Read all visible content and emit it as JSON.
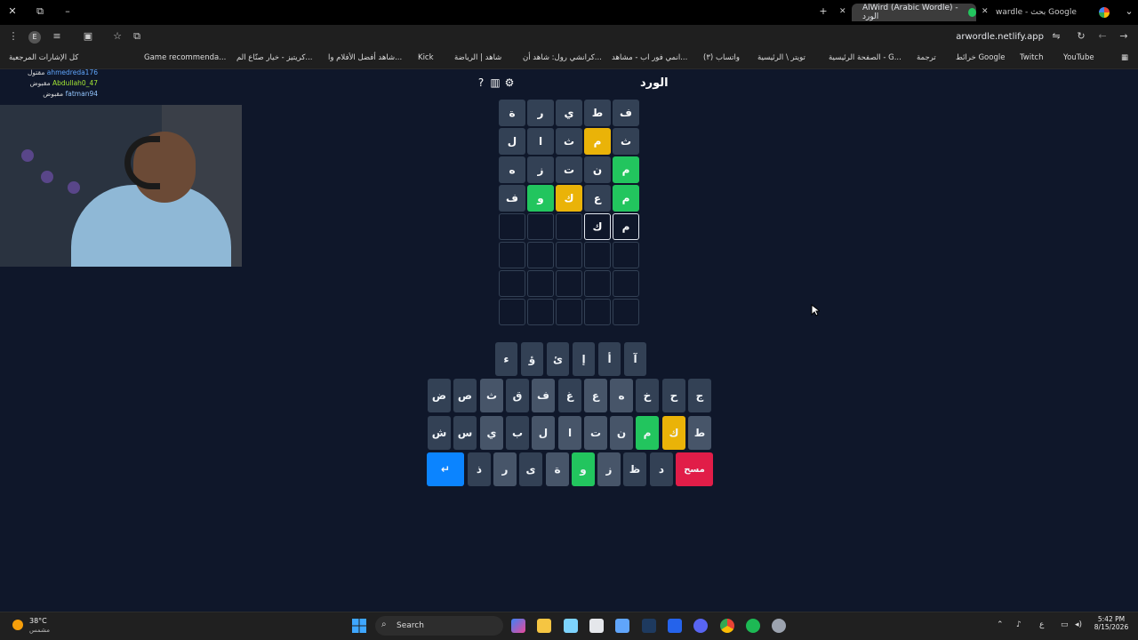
{
  "browser": {
    "tabs": [
      {
        "label": "AlWird (Arabic Wordle) - الورد",
        "active": true
      },
      {
        "label": "wardle - بحث Google",
        "active": false
      }
    ],
    "new_tab_glyph": "+",
    "url": "arwordle.netlify.app",
    "profile_letter": "E",
    "bookmarks": [
      {
        "label": "كل الإشارات المرجعية"
      },
      {
        "label": "Game recommenda..."
      },
      {
        "label": "كريتيز - خيار صنّاع الم..."
      },
      {
        "label": "شاهد أفضل الأفلام وا..."
      },
      {
        "label": "Kick"
      },
      {
        "label": "شاهد | الرياضة"
      },
      {
        "label": "كرانشي رول: شاهد أن..."
      },
      {
        "label": "انمي فور اب - مشاهد..."
      },
      {
        "label": "(٣) واتساب"
      },
      {
        "label": "تويتر \\ الرئيسية"
      },
      {
        "label": "الصفحة الرئيسية - G..."
      },
      {
        "label": "ترجمة"
      },
      {
        "label": "خرائط Google"
      },
      {
        "label": "Twitch"
      },
      {
        "label": "YouTube"
      }
    ]
  },
  "chat": [
    {
      "user": "ahmedreda176",
      "status": "مقتول",
      "color": "#60a5fa"
    },
    {
      "user": "Abdullah0_47",
      "status": "مقبوض",
      "color": "#a3e635"
    },
    {
      "user": "fatman94",
      "status": "مقبوض",
      "color": "#93c5fd"
    }
  ],
  "game": {
    "title": "الورد",
    "icons": [
      "help-icon",
      "stats-icon",
      "settings-icon"
    ],
    "rows": [
      [
        {
          "l": "ف",
          "s": "gray"
        },
        {
          "l": "ط",
          "s": "gray"
        },
        {
          "l": "ي",
          "s": "gray"
        },
        {
          "l": "ر",
          "s": "gray"
        },
        {
          "l": "ة",
          "s": "gray"
        }
      ],
      [
        {
          "l": "ث",
          "s": "gray"
        },
        {
          "l": "م",
          "s": "yellow"
        },
        {
          "l": "ث",
          "s": "gray"
        },
        {
          "l": "ا",
          "s": "gray"
        },
        {
          "l": "ل",
          "s": "gray"
        }
      ],
      [
        {
          "l": "م",
          "s": "green"
        },
        {
          "l": "ن",
          "s": "gray"
        },
        {
          "l": "ت",
          "s": "gray"
        },
        {
          "l": "ز",
          "s": "gray"
        },
        {
          "l": "ه",
          "s": "gray"
        }
      ],
      [
        {
          "l": "م",
          "s": "green"
        },
        {
          "l": "ع",
          "s": "gray"
        },
        {
          "l": "ك",
          "s": "yellow"
        },
        {
          "l": "و",
          "s": "green"
        },
        {
          "l": "ف",
          "s": "gray"
        }
      ],
      [
        {
          "l": "م",
          "s": "typed"
        },
        {
          "l": "ك",
          "s": "typed"
        },
        {
          "l": "",
          "s": "empty"
        },
        {
          "l": "",
          "s": "empty"
        },
        {
          "l": "",
          "s": "empty"
        }
      ],
      [
        {
          "l": "",
          "s": "empty"
        },
        {
          "l": "",
          "s": "empty"
        },
        {
          "l": "",
          "s": "empty"
        },
        {
          "l": "",
          "s": "empty"
        },
        {
          "l": "",
          "s": "empty"
        }
      ],
      [
        {
          "l": "",
          "s": "empty"
        },
        {
          "l": "",
          "s": "empty"
        },
        {
          "l": "",
          "s": "empty"
        },
        {
          "l": "",
          "s": "empty"
        },
        {
          "l": "",
          "s": "empty"
        }
      ],
      [
        {
          "l": "",
          "s": "empty"
        },
        {
          "l": "",
          "s": "empty"
        },
        {
          "l": "",
          "s": "empty"
        },
        {
          "l": "",
          "s": "empty"
        },
        {
          "l": "",
          "s": "empty"
        }
      ]
    ],
    "keyboard": [
      [
        {
          "l": "آ",
          "s": ""
        },
        {
          "l": "أ",
          "s": ""
        },
        {
          "l": "إ",
          "s": ""
        },
        {
          "l": "ئ",
          "s": ""
        },
        {
          "l": "ؤ",
          "s": ""
        },
        {
          "l": "ء",
          "s": ""
        }
      ],
      [
        {
          "l": "ج",
          "s": ""
        },
        {
          "l": "ح",
          "s": ""
        },
        {
          "l": "خ",
          "s": ""
        },
        {
          "l": "ه",
          "s": "gray"
        },
        {
          "l": "ع",
          "s": "gray"
        },
        {
          "l": "غ",
          "s": ""
        },
        {
          "l": "ف",
          "s": "gray"
        },
        {
          "l": "ق",
          "s": ""
        },
        {
          "l": "ث",
          "s": "gray"
        },
        {
          "l": "ص",
          "s": ""
        },
        {
          "l": "ض",
          "s": ""
        }
      ],
      [
        {
          "l": "ط",
          "s": "gray"
        },
        {
          "l": "ك",
          "s": "yellow"
        },
        {
          "l": "م",
          "s": "green"
        },
        {
          "l": "ن",
          "s": "gray"
        },
        {
          "l": "ت",
          "s": "gray"
        },
        {
          "l": "ا",
          "s": "gray"
        },
        {
          "l": "ل",
          "s": "gray"
        },
        {
          "l": "ب",
          "s": ""
        },
        {
          "l": "ي",
          "s": "gray"
        },
        {
          "l": "س",
          "s": ""
        },
        {
          "l": "ش",
          "s": ""
        }
      ],
      [
        {
          "l": "مسح",
          "s": "red"
        },
        {
          "l": "د",
          "s": ""
        },
        {
          "l": "ظ",
          "s": ""
        },
        {
          "l": "ز",
          "s": "gray"
        },
        {
          "l": "و",
          "s": "green"
        },
        {
          "l": "ة",
          "s": "gray"
        },
        {
          "l": "ى",
          "s": ""
        },
        {
          "l": "ر",
          "s": "gray"
        },
        {
          "l": "ذ",
          "s": ""
        },
        {
          "l": "↵",
          "s": "blue"
        }
      ]
    ]
  },
  "taskbar": {
    "temp": "38°C",
    "condition": "مشمس",
    "search": "Search",
    "lang": "ع",
    "time": "5:42 PM",
    "date": "8/15/2026"
  },
  "colors": {
    "green": "#22c55e",
    "yellow": "#eab308",
    "tile_gray": "#334155",
    "enter": "#0b84ff",
    "delete": "#e11d48"
  }
}
